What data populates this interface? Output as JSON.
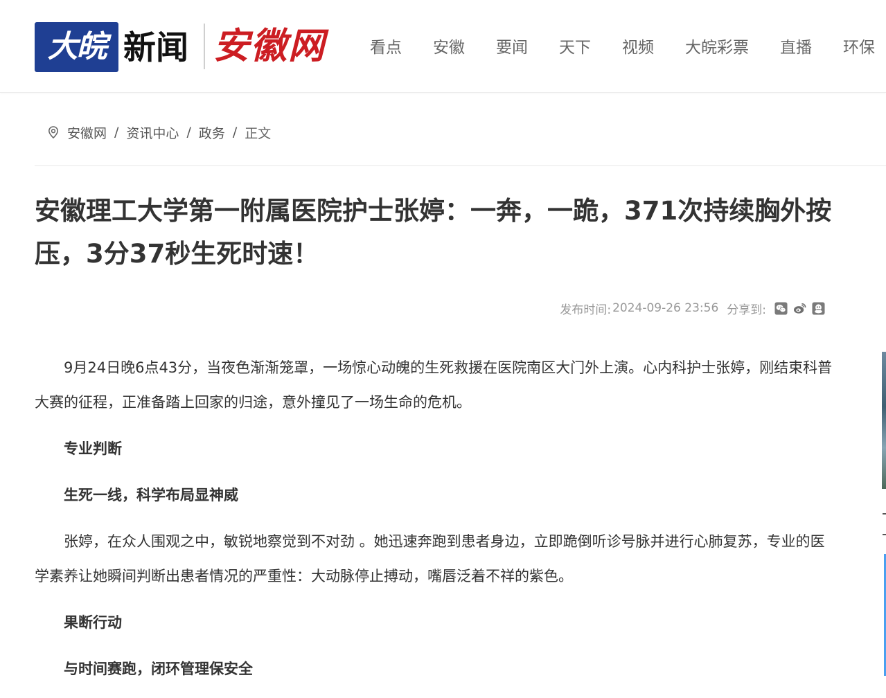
{
  "header": {
    "logo_mark": "大皖",
    "logo_news": "新闻",
    "logo_site": "安徽网",
    "nav": [
      "看点",
      "安徽",
      "要闻",
      "天下",
      "视频",
      "大皖彩票",
      "直播",
      "环保"
    ]
  },
  "breadcrumb": {
    "items": [
      "安徽网",
      "资讯中心",
      "政务"
    ],
    "separator": "/",
    "current": "正文"
  },
  "article": {
    "title": "安徽理工大学第一附属医院护士张婷：一奔，一跪，371次持续胸外按压，3分37秒生死时速！",
    "meta": {
      "publish_label": "发布时间:",
      "publish_time": "2024-09-26 23:56",
      "share_label": "分享到:",
      "share_icons": [
        "wechat-icon",
        "weibo-icon",
        "qq-icon"
      ]
    },
    "paragraphs": [
      {
        "type": "text",
        "text": "9月24日晚6点43分，当夜色渐渐笼罩，一场惊心动魄的生死救援在医院南区大门外上演。心内科护士张婷，刚结束科普大赛的征程，正准备踏上回家的归途，意外撞见了一场生命的危机。"
      },
      {
        "type": "sub",
        "text": "专业判断"
      },
      {
        "type": "sub",
        "text": "生死一线，科学布局显神威"
      },
      {
        "type": "text",
        "text": "张婷，在众人围观之中，敏锐地察觉到不对劲 。她迅速奔跑到患者身边，立即跪倒听诊号脉并进行心肺复苏，专业的医学素养让她瞬间判断出患者情况的严重性：大动脉停止搏动，嘴唇泛着不祥的紫色。"
      },
      {
        "type": "sub",
        "text": "果断行动"
      },
      {
        "type": "sub",
        "text": "与时间赛跑，闭环管理保安全"
      }
    ]
  },
  "colors": {
    "logo_blue": "#1f3f93",
    "logo_red": "#cc1d22",
    "nav_text": "#666666",
    "meta_text": "#999999"
  }
}
